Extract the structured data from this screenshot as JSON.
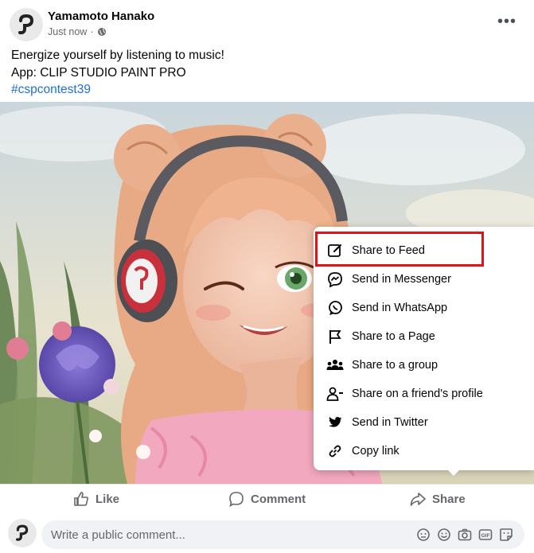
{
  "post": {
    "author": "Yamamoto Hanako",
    "time": "Just now",
    "audience_icon": "globe-icon",
    "line1": "Energize yourself by listening to music!",
    "line2": "App: CLIP STUDIO PAINT PRO",
    "hashtag": "#cspcontest39",
    "more_icon": "more-icon"
  },
  "share_menu": {
    "items": [
      {
        "label": "Share to Feed",
        "icon": "edit-icon"
      },
      {
        "label": "Send in Messenger",
        "icon": "messenger-icon"
      },
      {
        "label": "Send in WhatsApp",
        "icon": "whatsapp-icon"
      },
      {
        "label": "Share to a Page",
        "icon": "flag-icon"
      },
      {
        "label": "Share to a group",
        "icon": "group-icon"
      },
      {
        "label": "Share on a friend's profile",
        "icon": "friend-icon"
      },
      {
        "label": "Send in Twitter",
        "icon": "twitter-icon"
      },
      {
        "label": "Copy link",
        "icon": "link-icon"
      }
    ],
    "highlight_color": "#e21318"
  },
  "actions": {
    "like": "Like",
    "comment": "Comment",
    "share": "Share"
  },
  "composer": {
    "placeholder": "Write a public comment..."
  }
}
